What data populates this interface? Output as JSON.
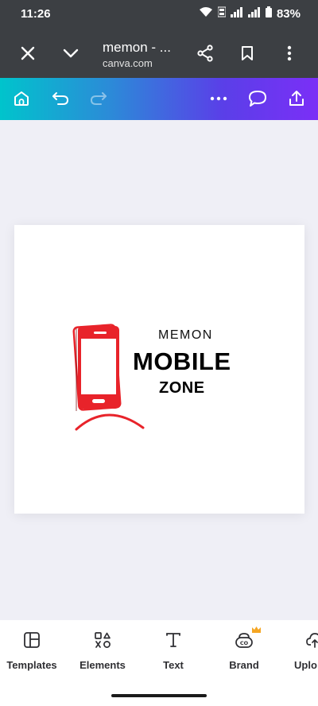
{
  "status": {
    "time": "11:26",
    "battery": "83%"
  },
  "browser": {
    "title": "memon - ...",
    "url": "canva.com",
    "icons": [
      "close-icon",
      "chevron-down-icon",
      "share-icon",
      "bookmark-icon",
      "more-vertical-icon"
    ]
  },
  "toolbar": {
    "icons": [
      "home-icon",
      "undo-icon",
      "redo-icon",
      "more-horizontal-icon",
      "comment-icon",
      "export-icon"
    ]
  },
  "design": {
    "brand": "MEMON",
    "main": "MOBILE",
    "sub": "ZONE",
    "accent_color": "#e8232a"
  },
  "tools": [
    {
      "label": "Templates",
      "icon": "templates-icon"
    },
    {
      "label": "Elements",
      "icon": "elements-icon"
    },
    {
      "label": "Text",
      "icon": "text-icon"
    },
    {
      "label": "Brand",
      "icon": "brand-icon",
      "badge": "crown-icon"
    },
    {
      "label": "Uplo",
      "icon": "upload-icon"
    }
  ]
}
